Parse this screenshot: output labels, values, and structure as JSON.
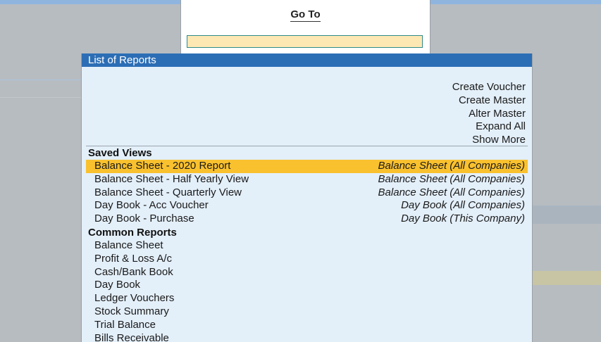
{
  "goto": {
    "title": "Go To",
    "input_value": ""
  },
  "reports": {
    "title": "List of Reports",
    "actions": [
      "Create Voucher",
      "Create Master",
      "Alter Master",
      "Expand All",
      "Show More"
    ],
    "saved_views_header": "Saved Views",
    "saved_views": [
      {
        "label": "Balance Sheet - 2020 Report",
        "scope": "Balance Sheet (All Companies)",
        "selected": true
      },
      {
        "label": "Balance Sheet - Half Yearly View",
        "scope": "Balance Sheet (All Companies)",
        "selected": false
      },
      {
        "label": "Balance Sheet - Quarterly View",
        "scope": "Balance Sheet (All Companies)",
        "selected": false
      },
      {
        "label": "Day Book - Acc Voucher",
        "scope": "Day Book (All Companies)",
        "selected": false
      },
      {
        "label": "Day Book - Purchase",
        "scope": "Day Book (This Company)",
        "selected": false
      }
    ],
    "common_reports_header": "Common Reports",
    "common_reports": [
      "Balance Sheet",
      "Profit & Loss A/c",
      "Cash/Bank Book",
      "Day Book",
      "Ledger Vouchers",
      "Stock Summary",
      "Trial Balance",
      "Bills Receivable"
    ]
  },
  "colors": {
    "title_bar": "#2c6eb5",
    "panel_bg": "#e3eff9",
    "selected_row": "#f9c12e",
    "input_bg": "#fde8b3",
    "input_border": "#2e8a8a"
  }
}
